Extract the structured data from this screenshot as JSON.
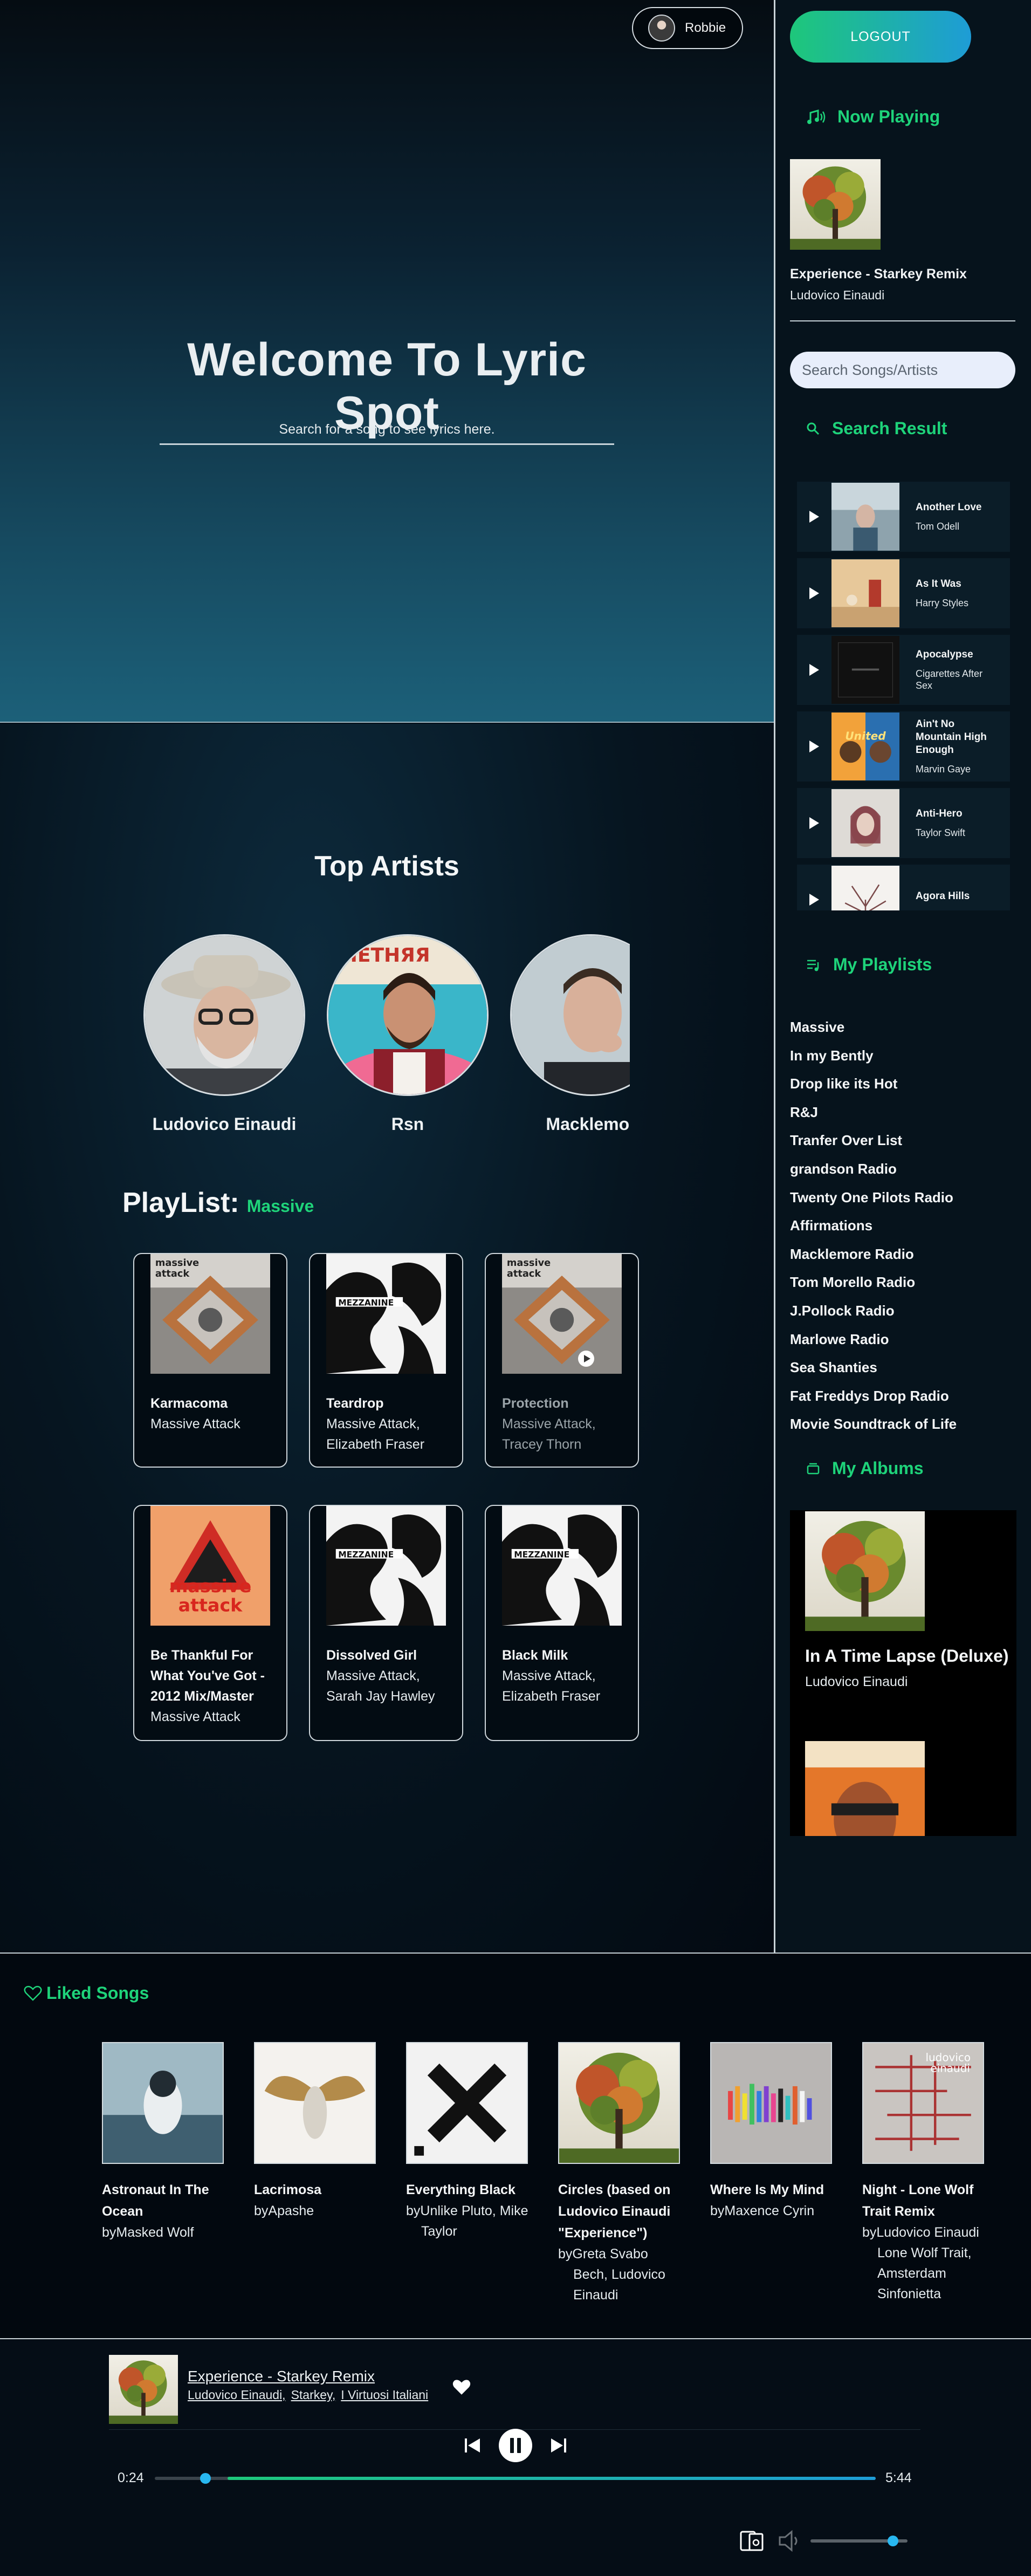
{
  "header": {
    "user_name": "Robbie"
  },
  "hero": {
    "title": "Welcome To Lyric Spot",
    "subtitle": "Search for a song to see lyrics here."
  },
  "top_artists": {
    "title": "Top Artists",
    "items": [
      {
        "name": "Ludovico Einaudi"
      },
      {
        "name": "Rsn"
      },
      {
        "name": "Macklemor"
      }
    ]
  },
  "playlist": {
    "label": "PlayList:",
    "name": "Massive",
    "tracks": [
      {
        "title": "Karmacoma",
        "artists": "Massive Attack",
        "dimmed": false,
        "art": "mezzanine-cross"
      },
      {
        "title": "Teardrop",
        "artists": "Massive Attack, Elizabeth Fraser",
        "dimmed": false,
        "art": "mezzanine"
      },
      {
        "title": "Protection",
        "artists": "Massive Attack, Tracey Thorn",
        "dimmed": true,
        "art": "mezzanine-cross"
      },
      {
        "title": "Be Thankful For What You've Got - 2012 Mix/Master",
        "artists": "Massive Attack",
        "dimmed": false,
        "art": "blue-lines"
      },
      {
        "title": "Dissolved Girl",
        "artists": "Massive Attack, Sarah Jay Hawley",
        "dimmed": false,
        "art": "mezzanine"
      },
      {
        "title": "Black Milk",
        "artists": "Massive Attack, Elizabeth Fraser",
        "dimmed": false,
        "art": "mezzanine"
      }
    ]
  },
  "sidebar": {
    "logout_label": "LOGOUT",
    "now_playing": {
      "heading": "Now Playing",
      "title": "Experience - Starkey Remix",
      "artist": "Ludovico Einaudi"
    },
    "search": {
      "placeholder": "Search Songs/Artists"
    },
    "search_result": {
      "heading": "Search Result",
      "items": [
        {
          "title": "Another Love",
          "artist": "Tom Odell"
        },
        {
          "title": "As It Was",
          "artist": "Harry Styles"
        },
        {
          "title": "Apocalypse",
          "artist": "Cigarettes After Sex"
        },
        {
          "title": "Ain't No Mountain High Enough",
          "artist": "Marvin Gaye"
        },
        {
          "title": "Anti-Hero",
          "artist": "Taylor Swift"
        },
        {
          "title": "Agora Hills",
          "artist": ""
        }
      ]
    },
    "my_playlists": {
      "heading": "My Playlists",
      "items": [
        "Massive",
        "In my Bently",
        "Drop like its Hot",
        "R&J",
        "Tranfer Over List",
        "grandson Radio",
        "Twenty One Pilots Radio",
        "Affirmations",
        "Macklemore Radio",
        "Tom Morello Radio",
        "J.Pollock Radio",
        "Marlowe Radio",
        "Sea Shanties",
        "Fat Freddys Drop Radio",
        "Movie Soundtrack of Life"
      ]
    },
    "my_albums": {
      "heading": "My Albums",
      "items": [
        {
          "title": "In A Time Lapse (Deluxe)",
          "artist": "Ludovico Einaudi"
        }
      ]
    }
  },
  "liked_songs": {
    "heading": "Liked Songs",
    "items": [
      {
        "title": "Astronaut In The Ocean",
        "artists": "byMasked Wolf"
      },
      {
        "title": "Lacrimosa",
        "artists": "byApashe"
      },
      {
        "title": "Everything Black",
        "artists": "byUnlike Pluto, Mike Taylor"
      },
      {
        "title": "Circles (based on Ludovico Einaudi \"Experience\")",
        "artists": "byGreta Svabo Bech, Ludovico Einaudi"
      },
      {
        "title": "Where Is My Mind",
        "artists": "byMaxence Cyrin"
      },
      {
        "title": "Night - Lone Wolf Trait Remix",
        "artists": "byLudovico Einaudi Lone Wolf Trait, Amsterdam Sinfonietta"
      }
    ]
  },
  "player": {
    "title": "Experience - Starkey Remix",
    "artists": [
      "Ludovico Einaudi,",
      "Starkey,",
      "I Virtuosi Italiani"
    ],
    "elapsed": "0:24",
    "duration": "5:44",
    "progress": 0.07,
    "volume": 0.85
  },
  "icons": {
    "now_playing": "music-notes-icon",
    "search_result": "search-icon",
    "my_playlists": "playlist-icon",
    "my_albums": "album-icon",
    "liked": "heart-outline-icon"
  },
  "colors": {
    "accent": "#1ed37a",
    "accent_blue": "#1e9cd6",
    "background": "#06101a"
  }
}
